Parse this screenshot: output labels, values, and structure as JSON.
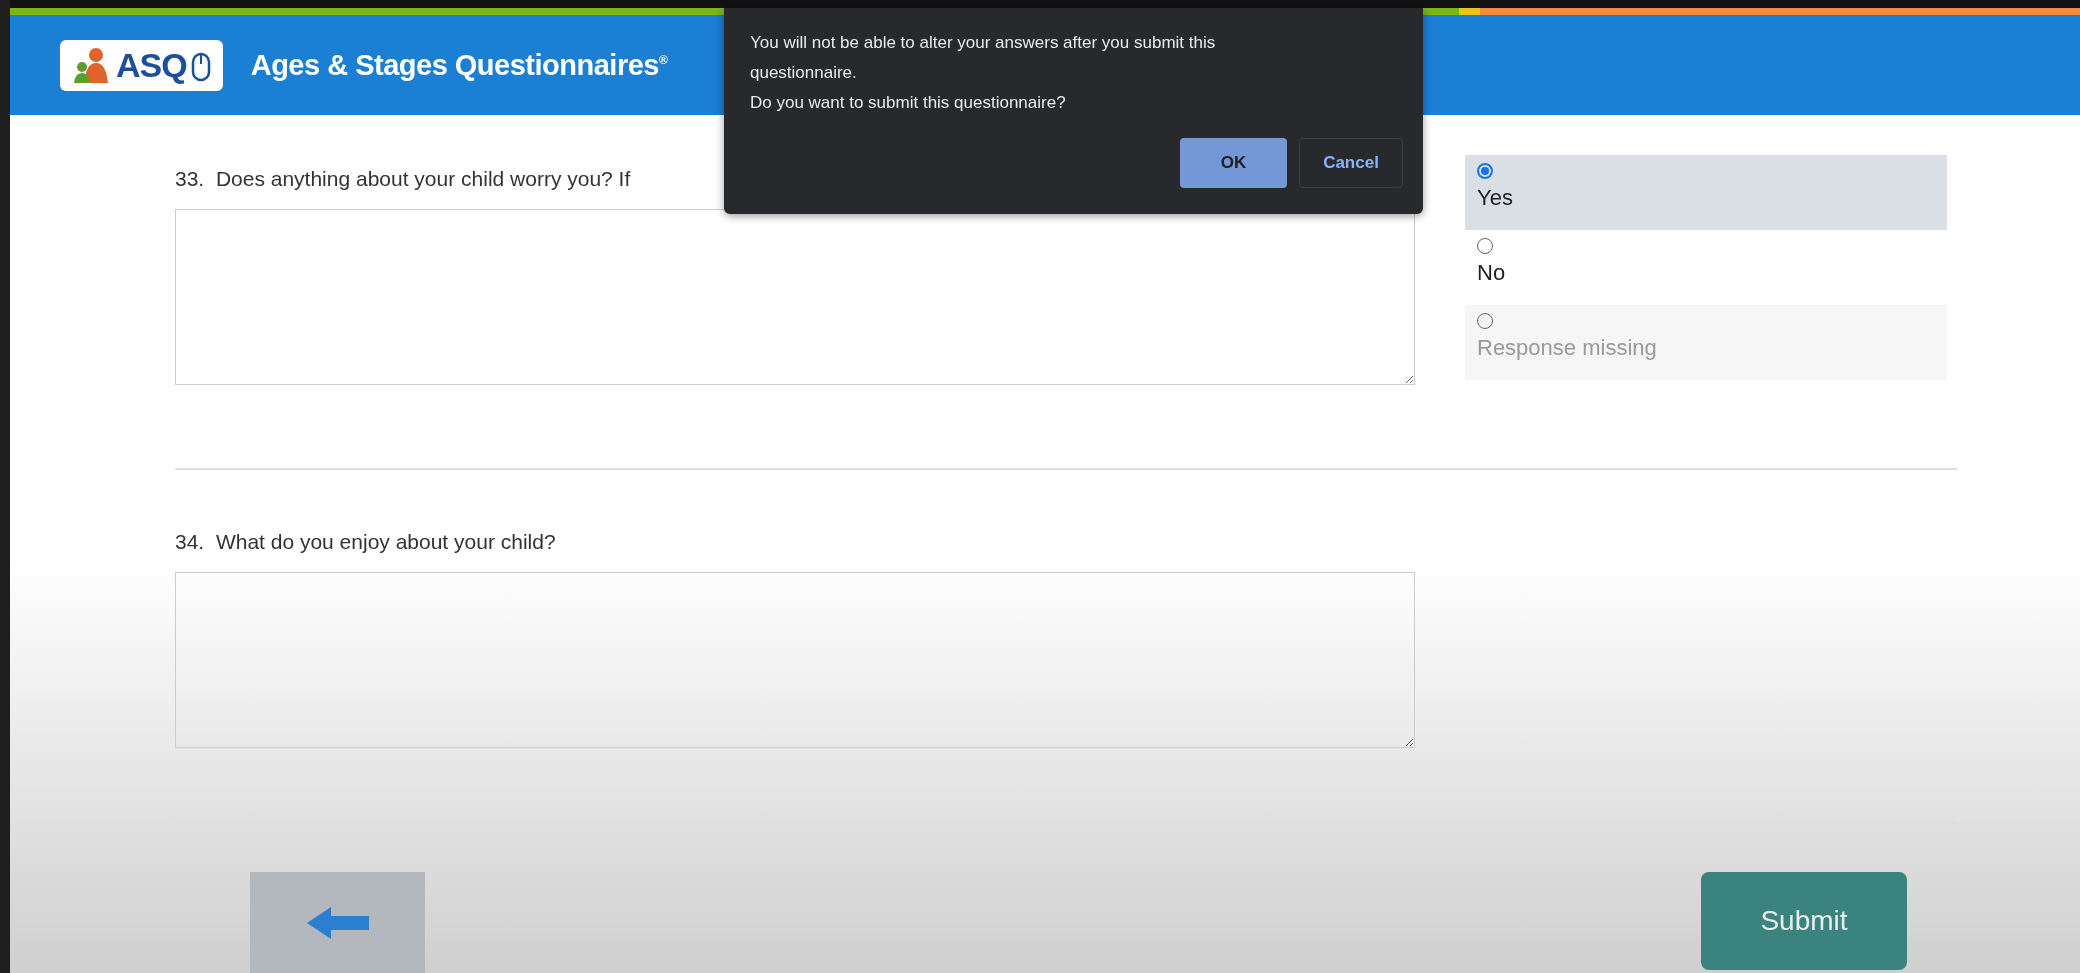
{
  "header": {
    "logo": "ASQ",
    "title": "Ages & Stages Questionnaires",
    "title_mark": "®"
  },
  "questions": [
    {
      "number": "33.",
      "text": "Does anything about your child worry you? If",
      "options": [
        {
          "label": "Yes",
          "selected": true,
          "disabled": false
        },
        {
          "label": "No",
          "selected": false,
          "disabled": false
        },
        {
          "label": "Response missing",
          "selected": false,
          "disabled": true
        }
      ]
    },
    {
      "number": "34.",
      "text": "What do you enjoy about your child?"
    }
  ],
  "footer": {
    "submit": "Submit"
  },
  "dialog": {
    "lines": [
      "You will not be able to alter your answers after you submit this questionnaire.",
      "Do you want to submit this questionnaire?"
    ],
    "buttons": [
      {
        "label": "OK",
        "kind": "primary"
      },
      {
        "label": "Cancel",
        "kind": "secondary"
      }
    ]
  }
}
